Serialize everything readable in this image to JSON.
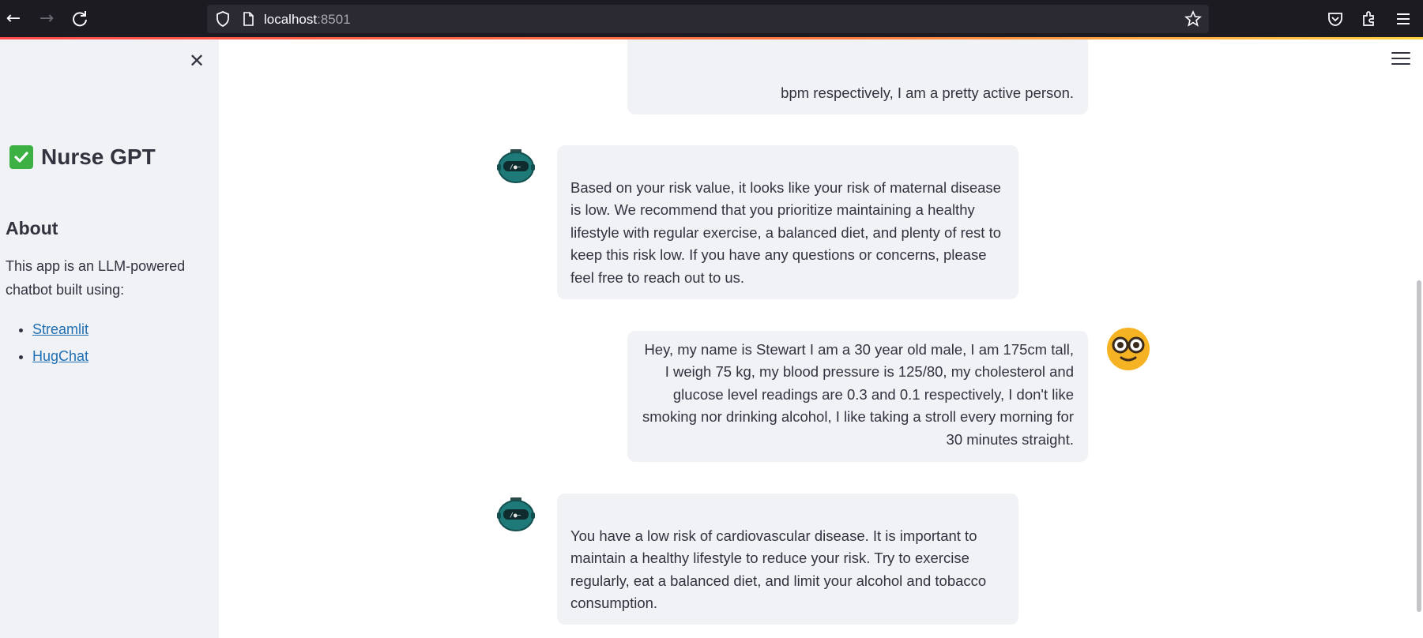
{
  "browser": {
    "url_host": "localhost",
    "url_port": ":8501"
  },
  "sidebar": {
    "app_title": "Nurse GPT",
    "about_heading": "About",
    "about_text": "This app is an LLM-powered chatbot built using:",
    "links": [
      {
        "label": "Streamlit"
      },
      {
        "label": "HugChat"
      }
    ]
  },
  "chat": {
    "messages": [
      {
        "role": "user",
        "text": "bpm respectively, I am a pretty active person."
      },
      {
        "role": "assistant",
        "text": "Based on your risk value, it looks like your risk of maternal disease is low. We recommend that you prioritize maintaining a healthy lifestyle with regular exercise, a balanced diet, and plenty of rest to keep this risk low. If you have any questions or concerns, please feel free to reach out to us."
      },
      {
        "role": "user",
        "text": "Hey, my name is Stewart I am a 30 year old male, I am 175cm tall, I weigh 75 kg, my blood pressure is 125/80, my cholesterol and glucose level readings are 0.3 and 0.1 respectively, I don't like smoking nor drinking alcohol, I like taking a stroll every morning for 30 minutes straight."
      },
      {
        "role": "assistant",
        "text": "You have a low risk of cardiovascular disease. It is important to maintain a healthy lifestyle to reduce your risk. Try to exercise regularly, eat a balanced diet, and limit your alcohol and tobacco consumption."
      }
    ]
  },
  "icons": {
    "bot_avatar": "robot-icon",
    "user_avatar": "nerd-face-icon",
    "title_icon": "check-mark-icon"
  },
  "colors": {
    "sidebar_bg": "#f0f2f6",
    "bubble_bg": "#f0f2f6",
    "link": "#1f6fb2",
    "check_green": "#3cb043"
  }
}
